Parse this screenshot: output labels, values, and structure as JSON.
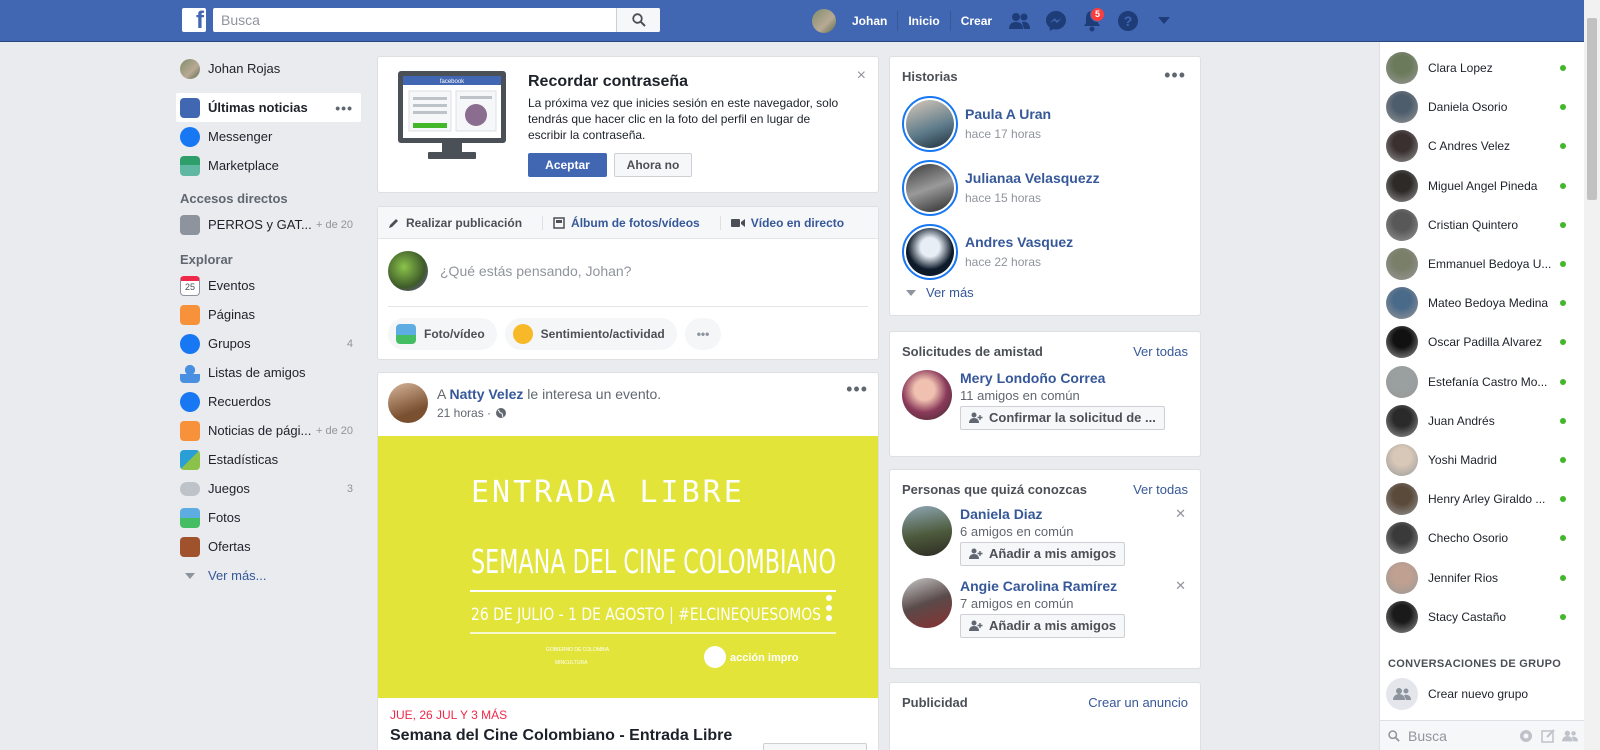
{
  "colors": {
    "brand": "#4267b2",
    "link": "#365899",
    "online": "#42b72a",
    "notification": "#fa3e3e",
    "event_bg": "#e2e43a"
  },
  "topbar": {
    "logo": "f",
    "search_placeholder": "Busca",
    "user_name": "Johan",
    "home": "Inicio",
    "create": "Crear",
    "notifications_count": "5",
    "icons": [
      "friends-icon",
      "messenger-icon",
      "notifications-icon",
      "help-icon",
      "dropdown-icon"
    ]
  },
  "left_nav": {
    "profile": "Johan Rojas",
    "main": [
      {
        "label": "Últimas noticias",
        "icon": "news-feed-icon"
      },
      {
        "label": "Messenger",
        "icon": "messenger-icon"
      },
      {
        "label": "Marketplace",
        "icon": "marketplace-icon"
      }
    ],
    "shortcuts_heading": "Accesos directos",
    "shortcuts": [
      {
        "label": "PERROS y GAT...",
        "count": "+ de 20"
      }
    ],
    "explore_heading": "Explorar",
    "explore": [
      {
        "label": "Eventos",
        "count": "",
        "icon": "calendar-icon"
      },
      {
        "label": "Páginas",
        "count": "",
        "icon": "flag-icon"
      },
      {
        "label": "Grupos",
        "count": "4",
        "icon": "groups-icon"
      },
      {
        "label": "Listas de amigos",
        "count": "",
        "icon": "friend-lists-icon"
      },
      {
        "label": "Recuerdos",
        "count": "",
        "icon": "memories-icon"
      },
      {
        "label": "Noticias de pági...",
        "count": "+ de 20",
        "icon": "pages-feed-icon"
      },
      {
        "label": "Estadísticas",
        "count": "",
        "icon": "insights-icon"
      },
      {
        "label": "Juegos",
        "count": "3",
        "icon": "gamepad-icon"
      },
      {
        "label": "Fotos",
        "count": "",
        "icon": "photos-icon"
      },
      {
        "label": "Ofertas",
        "count": "",
        "icon": "offers-icon"
      }
    ],
    "see_more": "Ver más..."
  },
  "password_card": {
    "title": "Recordar contraseña",
    "text": "La próxima vez que inicies sesión en este navegador, solo tendrás que hacer clic en la foto del perfil en lugar de escribir la contraseña.",
    "accept": "Aceptar",
    "later": "Ahora no",
    "illustration_logo": "facebook"
  },
  "composer": {
    "tab_post": "Realizar publicación",
    "tab_album": "Álbum de fotos/vídeos",
    "tab_live": "Vídeo en directo",
    "placeholder": "¿Qué estás pensando, Johan?",
    "photo": "Foto/vídeo",
    "feeling": "Sentimiento/actividad"
  },
  "post": {
    "prefix": "A",
    "author": "Natty Velez",
    "action": "le interesa un evento.",
    "time": "21 horas ·",
    "event_image": {
      "line1": "ENTRADA LIBRE",
      "line2": "SEMANA DEL CINE COLOMBIANO",
      "line3": "26 DE JULIO - 1 DE AGOSTO | #ELCINEQUESOMOS",
      "sponsor1": "GOBIERNO DE COLOMBIA",
      "sponsor2": "MINCULTURA",
      "brand": "acción impro"
    },
    "event_date": "JUE, 26 JUL Y 3 MÁS",
    "event_title": "Semana del Cine Colombiano - Entrada Libre"
  },
  "stories": {
    "title": "Historias",
    "items": [
      {
        "name": "Paula A Uran",
        "time": "hace 17 horas"
      },
      {
        "name": "Julianaa Velasquezz",
        "time": "hace 15 horas"
      },
      {
        "name": "Andres Vasquez",
        "time": "hace 22 horas"
      }
    ],
    "see_more": "Ver más"
  },
  "friend_requests": {
    "title": "Solicitudes de amistad",
    "see_all": "Ver todas",
    "items": [
      {
        "name": "Mery Londoño Correa",
        "mutual": "11 amigos en común",
        "button": "Confirmar la solicitud de ..."
      }
    ]
  },
  "pymk": {
    "title": "Personas que quizá conozcas",
    "see_all": "Ver todas",
    "items": [
      {
        "name": "Daniela Diaz",
        "mutual": "6 amigos en común",
        "button": "Añadir a mis amigos"
      },
      {
        "name": "Angie Carolina Ramírez",
        "mutual": "7 amigos en común",
        "button": "Añadir a mis amigos"
      }
    ]
  },
  "ads": {
    "title": "Publicidad",
    "create": "Crear un anuncio"
  },
  "chat": {
    "contacts": [
      "Clara Lopez",
      "Daniela Osorio",
      "C Andres Velez",
      "Miguel Angel Pineda",
      "Cristian Quintero",
      "Emmanuel Bedoya U...",
      "Mateo Bedoya Medina",
      "Oscar Padilla Alvarez",
      "Estefanía Castro Mo...",
      "Juan Andrés",
      "Yoshi Madrid",
      "Henry Arley Giraldo ...",
      "Checho Osorio",
      "Jennifer Rios",
      "Stacy Castaño"
    ],
    "group_heading": "CONVERSACIONES DE GRUPO",
    "new_group": "Crear nuevo grupo",
    "search_placeholder": "Busca"
  }
}
